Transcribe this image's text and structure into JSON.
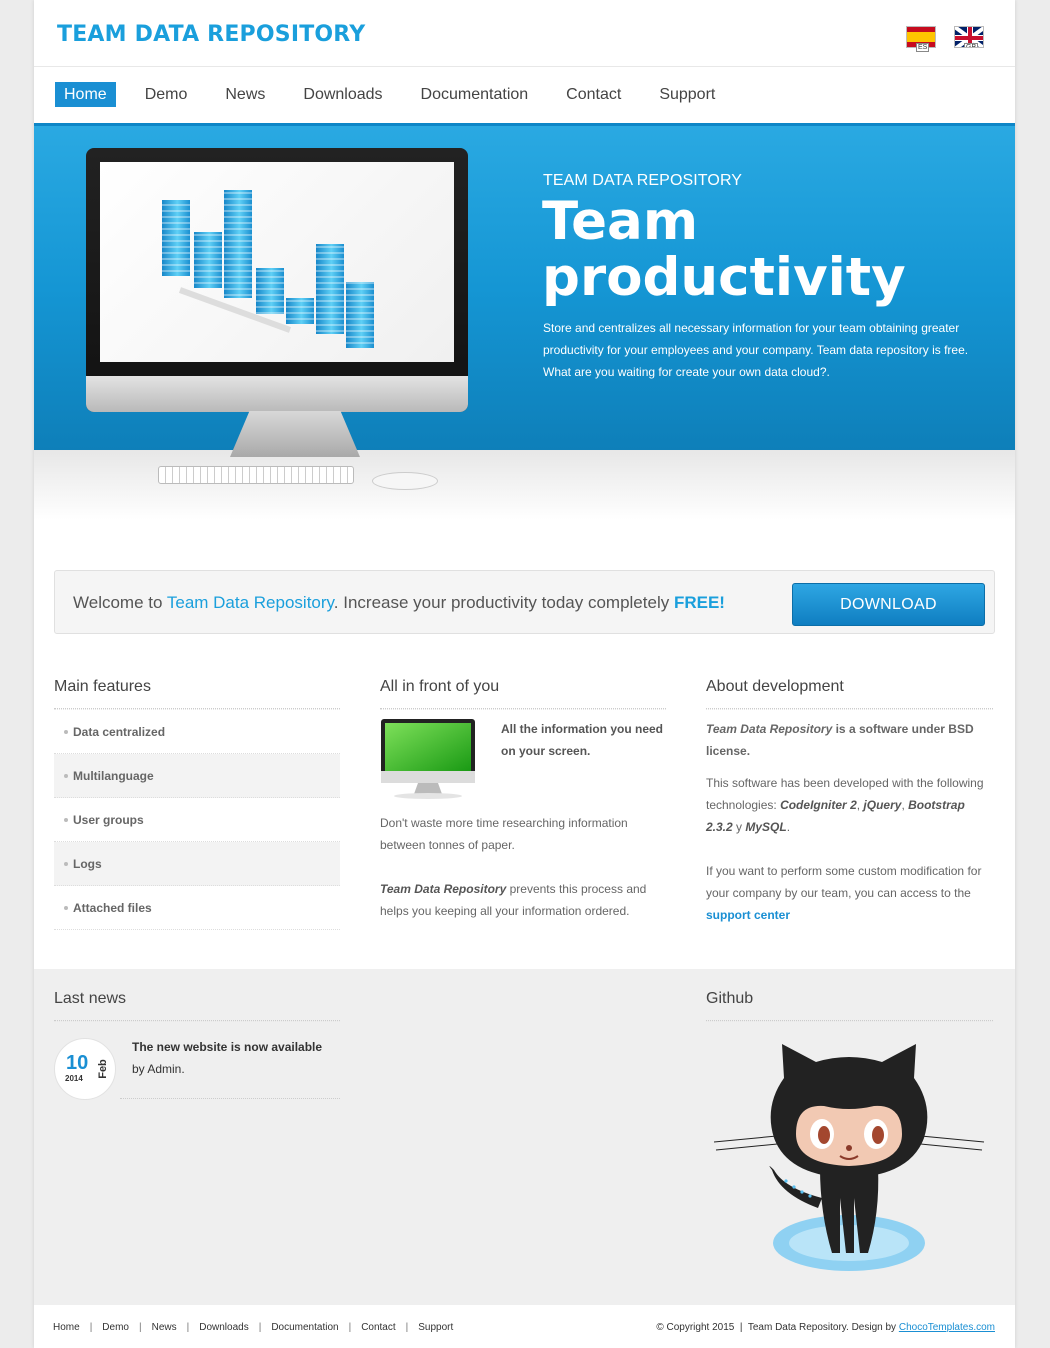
{
  "header": {
    "brand": "TEAM DATA REPOSITORY",
    "flags": [
      {
        "code": "ES",
        "icon": "spain-flag-icon"
      },
      {
        "code": "GB",
        "icon": "uk-flag-icon"
      }
    ]
  },
  "nav": {
    "items": [
      "Home",
      "Demo",
      "News",
      "Downloads",
      "Documentation",
      "Contact",
      "Support"
    ],
    "active": "Home"
  },
  "hero": {
    "kicker": "TEAM DATA REPOSITORY",
    "title_line1": "Team",
    "title_line2": "productivity",
    "text": "Store and centralizes all necessary information for your team obtaining greater productivity for your employees and your company. Team data repository is free. What are you waiting for create your own data cloud?."
  },
  "welcome": {
    "prefix": "Welcome to ",
    "brand": "Team Data Repository",
    "middle": ". Increase your productivity today completely ",
    "free": "FREE!",
    "button": "DOWNLOAD"
  },
  "features": {
    "title": "Main features",
    "items": [
      "Data centralized",
      "Multilanguage",
      "User groups",
      "Logs",
      "Attached files"
    ]
  },
  "front": {
    "title": "All in front of you",
    "lead_line1": "All the information you need",
    "lead_line2": "on your screen.",
    "p1": "Don't waste more time researching information between tonnes of paper.",
    "p2_em": "Team Data Repository",
    "p2_rest": " prevents this process and helps you keeping all your information ordered."
  },
  "about": {
    "title": "About development",
    "p1_em": "Team Data Repository",
    "p1_rest": " is a software under BSD license.",
    "p2_intro": "This software has been developed with the following technologies: ",
    "tech1": "CodeIgniter 2",
    "tech2": "jQuery",
    "tech3": "Bootstrap 2.3.2",
    "conj": " y ",
    "tech4": "MySQL",
    "p3": "If you want to perform some custom modification for your company by our team, you can access to the ",
    "p3_link": "support center"
  },
  "news": {
    "title": "Last news",
    "date_day": "10",
    "date_month": "Feb",
    "date_year": "2014",
    "item_title": "The new website is now available",
    "item_by": "by Admin."
  },
  "github": {
    "title": "Github"
  },
  "footer": {
    "nav": [
      "Home",
      "Demo",
      "News",
      "Downloads",
      "Documentation",
      "Contact",
      "Support"
    ],
    "copyright": "© Copyright 2015  |  Team Data Repository. Design by ",
    "designer": "ChocoTemplates.com"
  },
  "colors": {
    "accent": "#1a9fdc",
    "hero": "#1596d4",
    "button": "#1a8fd3"
  }
}
